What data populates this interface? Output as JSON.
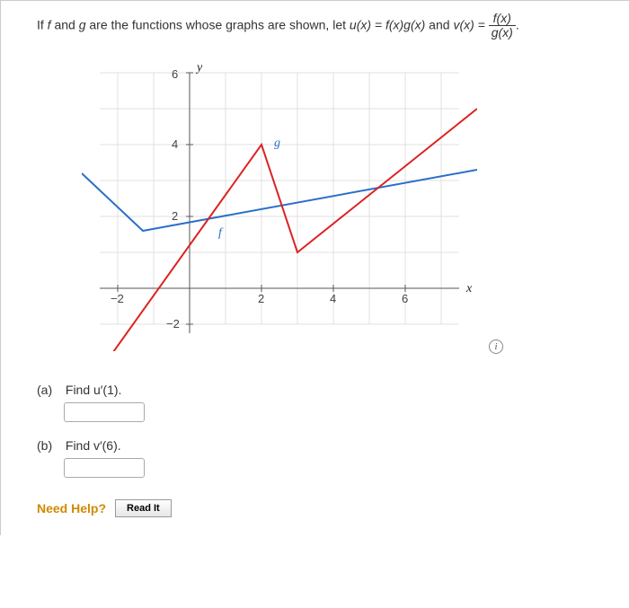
{
  "prompt": {
    "text1": "If ",
    "f": "f",
    "text2": " and ",
    "g": "g",
    "text3": " are the functions whose graphs are shown, let ",
    "u_def": "u(x) = f(x)g(x)",
    "text4": " and ",
    "v_lhs": "v(x) = ",
    "frac_num": "f(x)",
    "frac_den": "g(x)",
    "text5": "."
  },
  "chart_data": {
    "type": "line",
    "xlabel": "x",
    "ylabel": "y",
    "xlim": [
      -3,
      8
    ],
    "ylim": [
      -3,
      7
    ],
    "xticks": [
      -2,
      2,
      4,
      6
    ],
    "yticks": [
      -2,
      2,
      4,
      6
    ],
    "series": [
      {
        "name": "f",
        "color": "#d22",
        "segments": [
          {
            "points": [
              [
                -3,
                -3
              ],
              [
                2,
                4
              ]
            ]
          },
          {
            "points": [
              [
                2,
                4
              ],
              [
                3,
                1
              ]
            ]
          },
          {
            "points": [
              [
                3,
                1
              ],
              [
                8,
                5
              ]
            ]
          }
        ],
        "label_pos": [
          1,
          1.6
        ]
      },
      {
        "name": "g",
        "color": "#2a6fc9",
        "segments": [
          {
            "points": [
              [
                -3,
                3.2
              ],
              [
                -1.3,
                1.6
              ]
            ]
          },
          {
            "points": [
              [
                -1.3,
                1.6
              ],
              [
                8,
                3.3
              ]
            ]
          }
        ],
        "label_pos": [
          2.4,
          4.1
        ]
      }
    ]
  },
  "axis_labels": {
    "x": "x",
    "y": "y"
  },
  "tick_labels": {
    "xn2": "−2",
    "x2": "2",
    "x4": "4",
    "x6": "6",
    "yn2": "−2",
    "y2": "2",
    "y4": "4",
    "y6": "6"
  },
  "curve_labels": {
    "f": "f",
    "g": "g"
  },
  "questions": {
    "a": {
      "label": "(a)",
      "text": "Find u′(1)."
    },
    "b": {
      "label": "(b)",
      "text": "Find v′(6)."
    }
  },
  "help": {
    "need_help": "Need Help?",
    "read_it": "Read It"
  },
  "info_icon": "i"
}
